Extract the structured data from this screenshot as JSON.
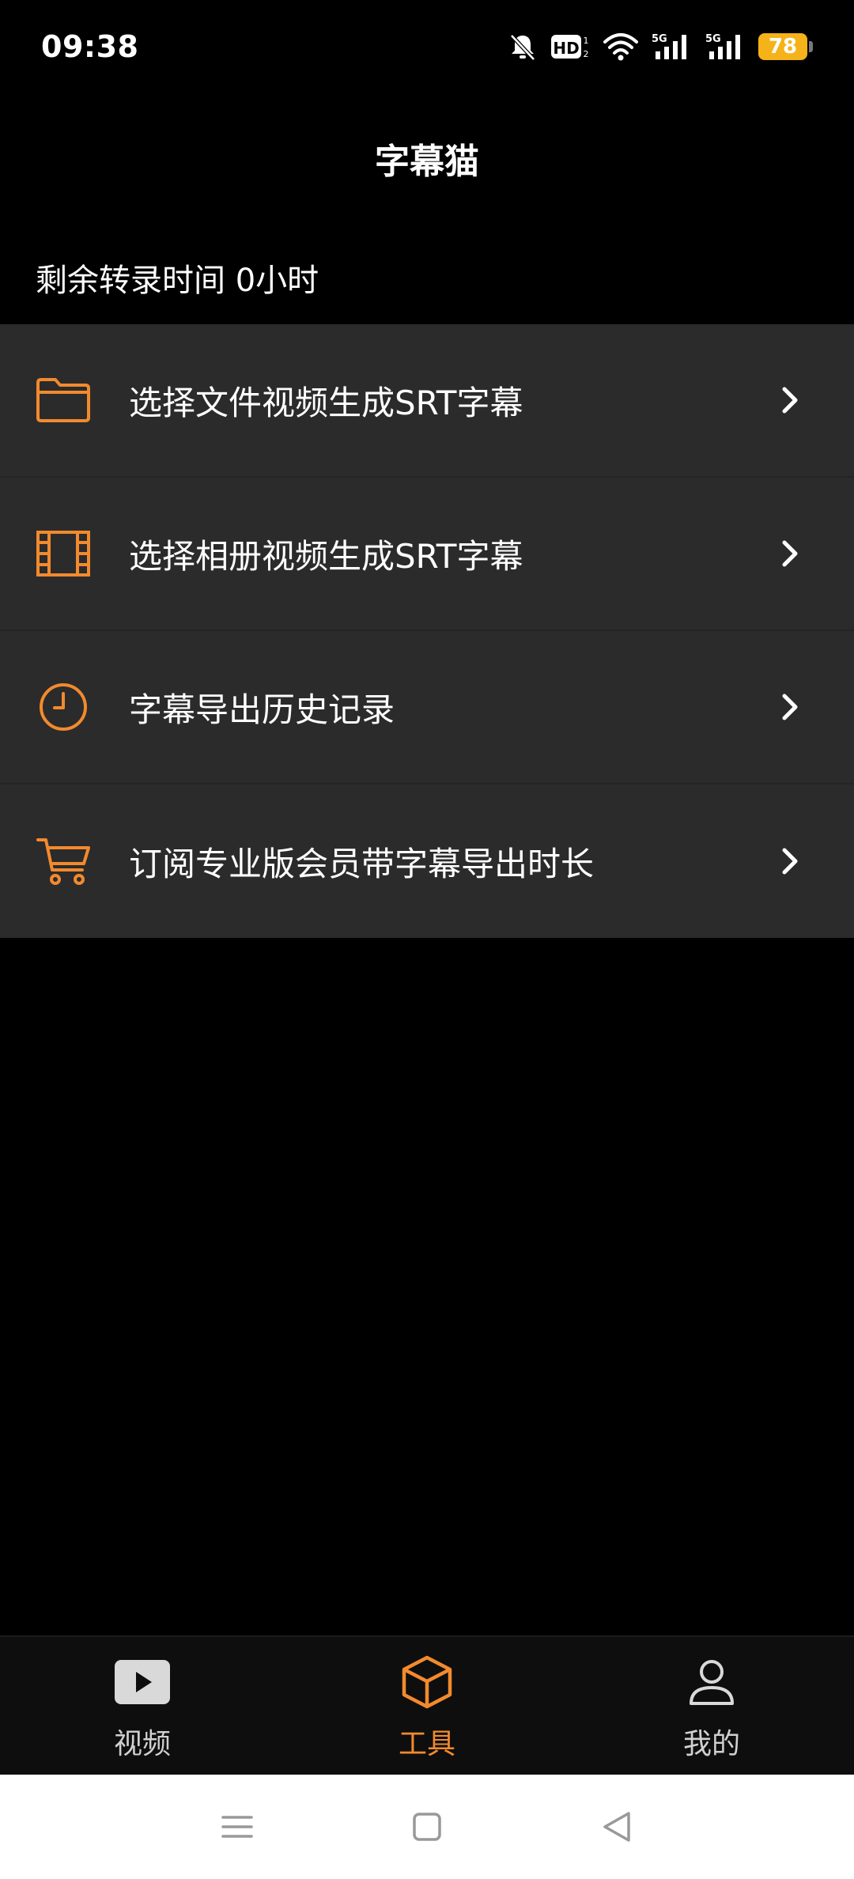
{
  "status_bar": {
    "time": "09:38",
    "battery": "78",
    "icons": [
      "bell-muted-icon",
      "hd-icon",
      "wifi-icon",
      "5g-signal-icon",
      "5g-signal-icon",
      "battery-icon"
    ]
  },
  "header": {
    "title": "字幕猫"
  },
  "remaining_time": {
    "text": "剩余转录时间  0小时"
  },
  "menu": {
    "items": [
      {
        "label": "选择文件视频生成SRT字幕",
        "icon": "folder-icon"
      },
      {
        "label": "选择相册视频生成SRT字幕",
        "icon": "film-icon"
      },
      {
        "label": "字幕导出历史记录",
        "icon": "clock-icon"
      },
      {
        "label": "订阅专业版会员带字幕导出时长",
        "icon": "cart-icon"
      }
    ]
  },
  "bottom_nav": {
    "items": [
      {
        "label": "视频",
        "icon": "video-play-icon",
        "active": false
      },
      {
        "label": "工具",
        "icon": "box-icon",
        "active": true
      },
      {
        "label": "我的",
        "icon": "person-icon",
        "active": false
      }
    ]
  },
  "colors": {
    "accent": "#f28a2e",
    "background": "#000000",
    "list_bg": "#2b2b2b",
    "battery": "#f5b319"
  }
}
